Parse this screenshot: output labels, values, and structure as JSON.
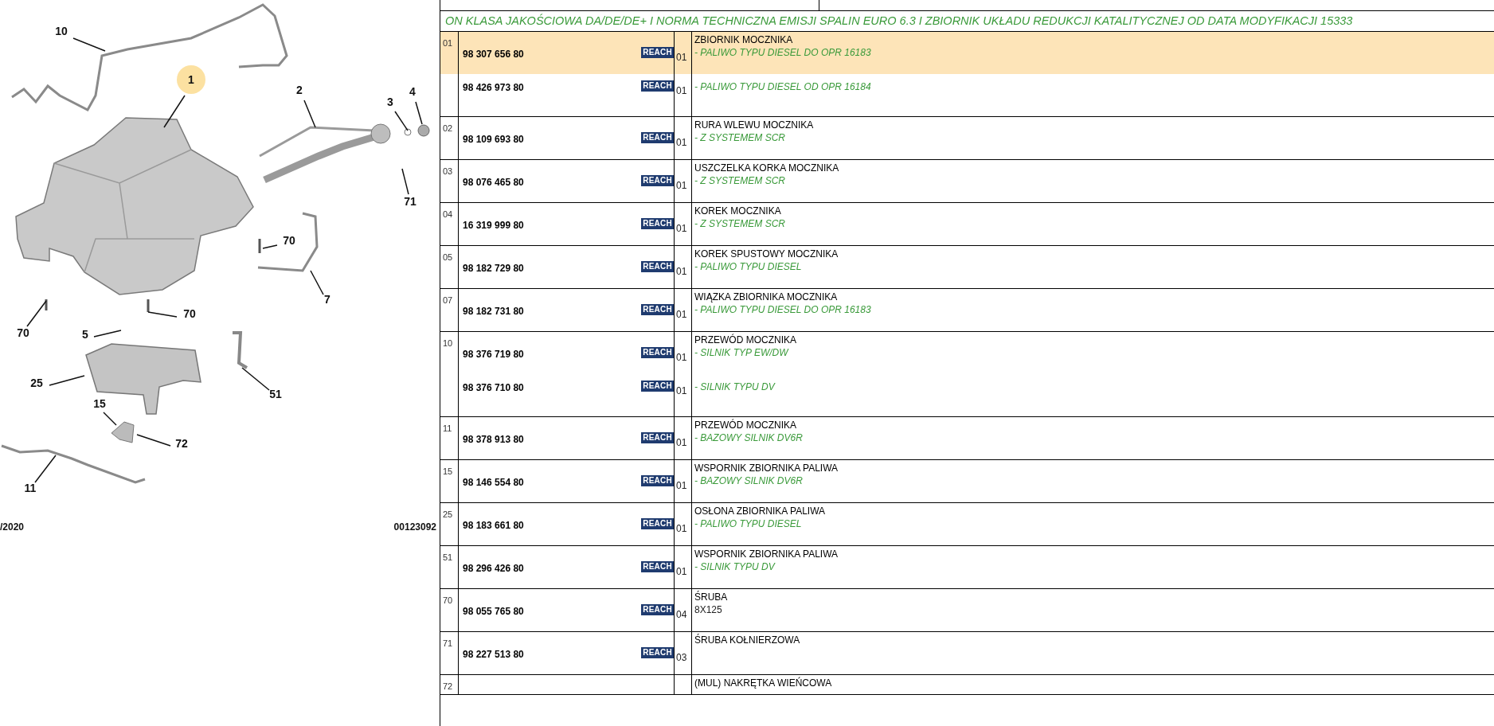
{
  "diagram": {
    "callouts": [
      {
        "label": "10",
        "highlighted": false
      },
      {
        "label": "1",
        "highlighted": true
      },
      {
        "label": "2",
        "highlighted": false
      },
      {
        "label": "3",
        "highlighted": false
      },
      {
        "label": "4",
        "highlighted": false
      },
      {
        "label": "71",
        "highlighted": false
      },
      {
        "label": "70",
        "highlighted": false
      },
      {
        "label": "7",
        "highlighted": false
      },
      {
        "label": "70",
        "highlighted": false
      },
      {
        "label": "70",
        "highlighted": false
      },
      {
        "label": "5",
        "highlighted": false
      },
      {
        "label": "25",
        "highlighted": false
      },
      {
        "label": "51",
        "highlighted": false
      },
      {
        "label": "15",
        "highlighted": false
      },
      {
        "label": "72",
        "highlighted": false
      },
      {
        "label": "11",
        "highlighted": false
      }
    ],
    "date": "/2020",
    "code": "00123092"
  },
  "table": {
    "banner": "ON KLASA JAKOŚCIOWA DA/DE/DE+ I NORMA TECHNICZNA EMISJI SPALIN EURO 6.3 I ZBIORNIK UKŁADU REDUKCJI KATALITYCZNEJ OD DATA MODYFIKACJI 15333",
    "groups": [
      {
        "index": "01",
        "title": "ZBIORNIK MOCZNIKA",
        "parts": [
          {
            "number": "98 307 656 80",
            "badge": "REACH",
            "qty": "01",
            "note": "- PALIWO TYPU DIESEL DO OPR 16183",
            "kind": "variant",
            "selected": true
          },
          {
            "number": "98 426 973 80",
            "badge": "REACH",
            "qty": "01",
            "note": "- PALIWO TYPU DIESEL OD OPR 16184",
            "kind": "variant",
            "selected": false
          }
        ]
      },
      {
        "index": "02",
        "title": "RURA WLEWU MOCZNIKA",
        "parts": [
          {
            "number": "98 109 693 80",
            "badge": "REACH",
            "qty": "01",
            "note": "- Z SYSTEMEM SCR",
            "kind": "variant",
            "selected": false
          }
        ]
      },
      {
        "index": "03",
        "title": "USZCZELKA KORKA MOCZNIKA",
        "parts": [
          {
            "number": "98 076 465 80",
            "badge": "REACH",
            "qty": "01",
            "note": "- Z SYSTEMEM SCR",
            "kind": "variant",
            "selected": false
          }
        ]
      },
      {
        "index": "04",
        "title": "KOREK MOCZNIKA",
        "parts": [
          {
            "number": "16 319 999 80",
            "badge": "REACH",
            "qty": "01",
            "note": "- Z SYSTEMEM SCR",
            "kind": "variant",
            "selected": false
          }
        ]
      },
      {
        "index": "05",
        "title": "KOREK SPUSTOWY MOCZNIKA",
        "parts": [
          {
            "number": "98 182 729 80",
            "badge": "REACH",
            "qty": "01",
            "note": "- PALIWO TYPU DIESEL",
            "kind": "variant",
            "selected": false
          }
        ]
      },
      {
        "index": "07",
        "title": "WIĄZKA ZBIORNIKA MOCZNIKA",
        "parts": [
          {
            "number": "98 182 731 80",
            "badge": "REACH",
            "qty": "01",
            "note": "- PALIWO TYPU DIESEL DO OPR 16183",
            "kind": "variant",
            "selected": false
          }
        ]
      },
      {
        "index": "10",
        "title": "PRZEWÓD MOCZNIKA",
        "parts": [
          {
            "number": "98 376 719 80",
            "badge": "REACH",
            "qty": "01",
            "note": "- SILNIK TYP EW/DW",
            "kind": "variant",
            "selected": false
          },
          {
            "number": "98 376 710 80",
            "badge": "REACH",
            "qty": "01",
            "note": "- SILNIK TYPU DV",
            "kind": "variant",
            "selected": false
          }
        ]
      },
      {
        "index": "11",
        "title": "PRZEWÓD MOCZNIKA",
        "parts": [
          {
            "number": "98 378 913 80",
            "badge": "REACH",
            "qty": "01",
            "note": "- BAZOWY SILNIK DV6R",
            "kind": "variant",
            "selected": false
          }
        ]
      },
      {
        "index": "15",
        "title": "WSPORNIK ZBIORNIKA PALIWA",
        "parts": [
          {
            "number": "98 146 554 80",
            "badge": "REACH",
            "qty": "01",
            "note": "- BAZOWY SILNIK DV6R",
            "kind": "variant",
            "selected": false
          }
        ]
      },
      {
        "index": "25",
        "title": "OSŁONA ZBIORNIKA PALIWA",
        "parts": [
          {
            "number": "98 183 661 80",
            "badge": "REACH",
            "qty": "01",
            "note": "- PALIWO TYPU DIESEL",
            "kind": "variant",
            "selected": false
          }
        ]
      },
      {
        "index": "51",
        "title": "WSPORNIK ZBIORNIKA PALIWA",
        "parts": [
          {
            "number": "98 296 426 80",
            "badge": "REACH",
            "qty": "01",
            "note": "- SILNIK TYPU DV",
            "kind": "variant",
            "selected": false
          }
        ]
      },
      {
        "index": "70",
        "title": "ŚRUBA",
        "parts": [
          {
            "number": "98 055 765 80",
            "badge": "REACH",
            "qty": "04",
            "note": "8X125",
            "kind": "spec",
            "selected": false
          }
        ]
      },
      {
        "index": "71",
        "title": "ŚRUBA KOŁNIERZOWA",
        "parts": [
          {
            "number": "98 227 513 80",
            "badge": "REACH",
            "qty": "03",
            "selected": false
          }
        ]
      },
      {
        "index": "72",
        "title": "(MUL) NAKRĘTKA WIEŃCOWA"
      }
    ]
  }
}
